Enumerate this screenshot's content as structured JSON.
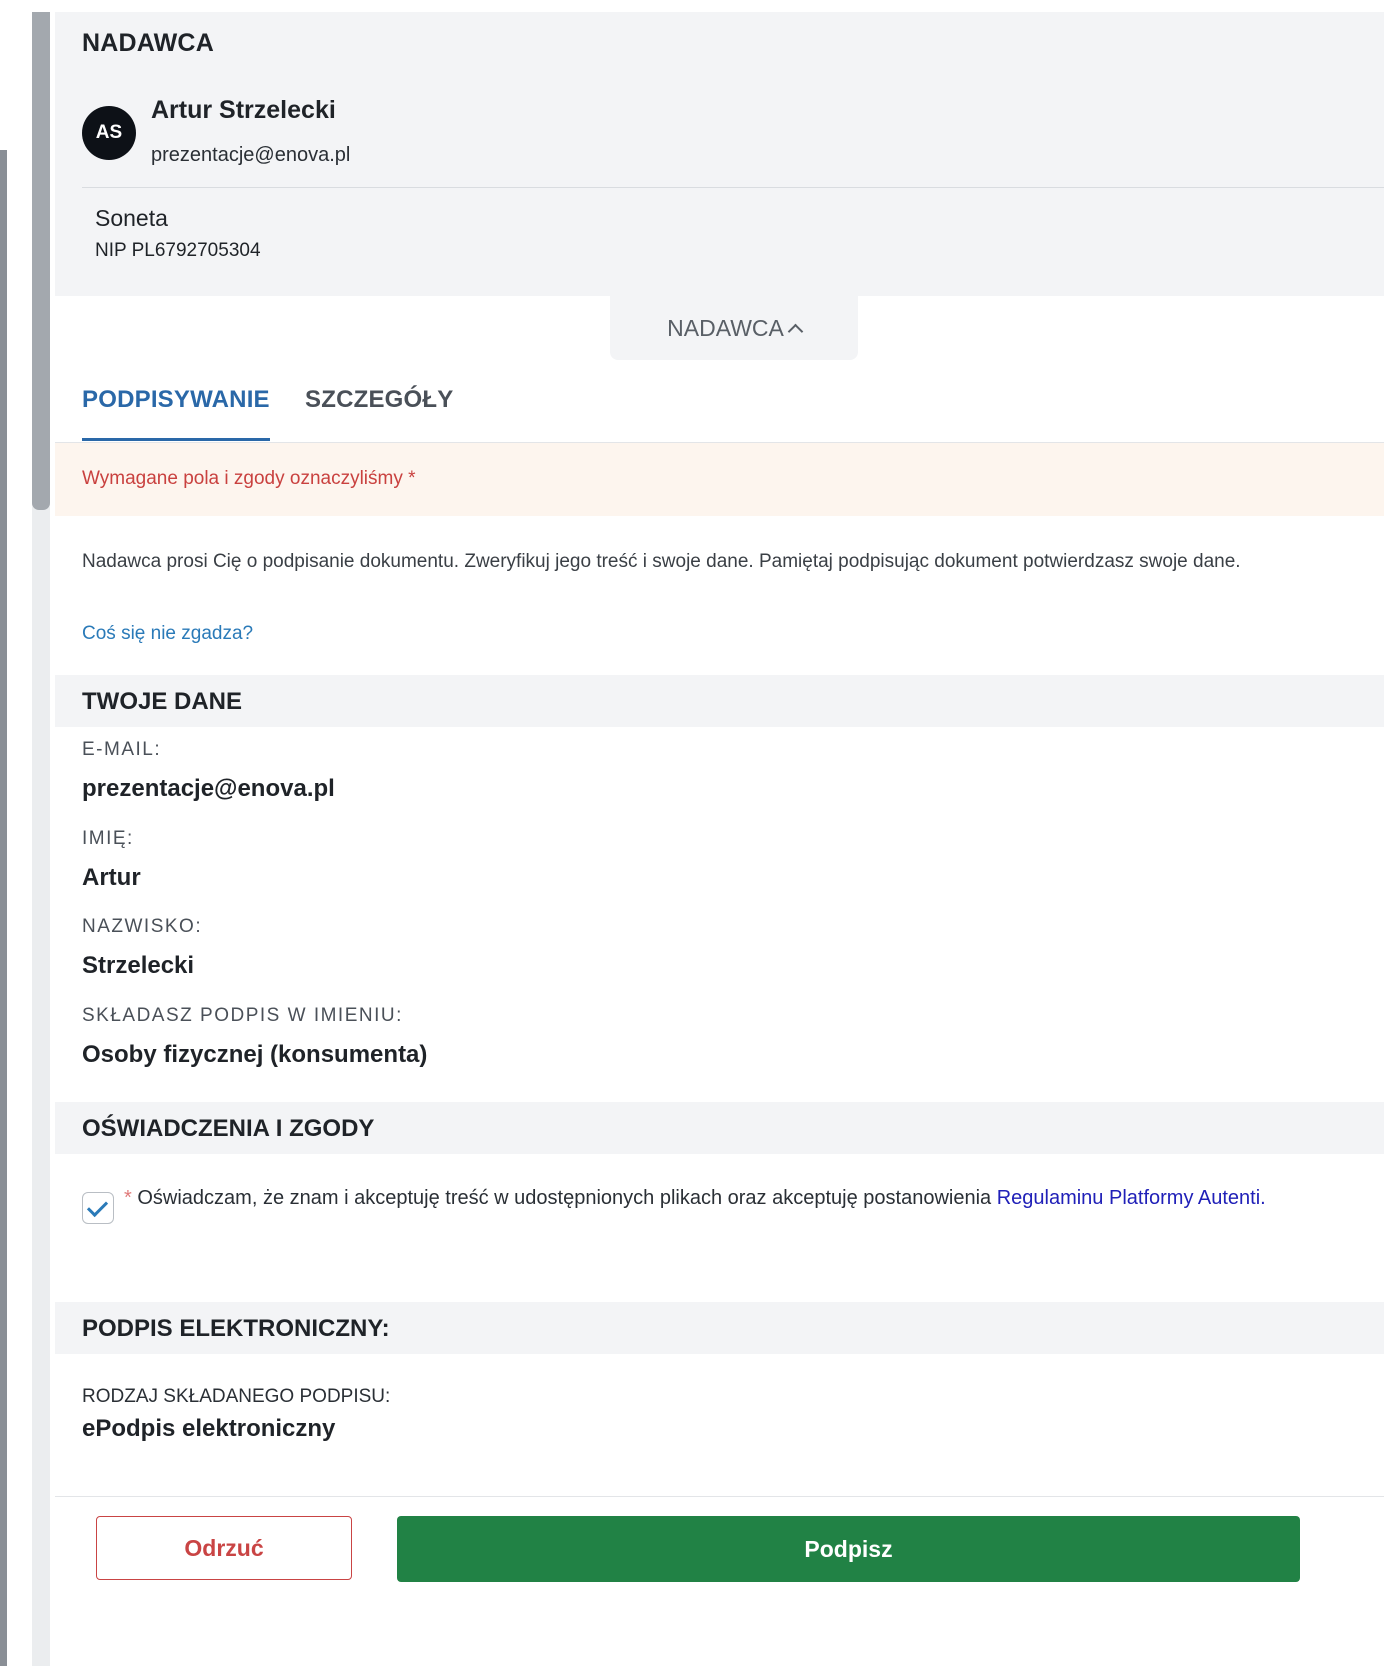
{
  "sender": {
    "heading": "NADAWCA",
    "avatar_initials": "AS",
    "name": "Artur Strzelecki",
    "email": "prezentacje@enova.pl",
    "org_name": "Soneta",
    "org_nip": "NIP PL6792705304",
    "collapse_label": "NADAWCA"
  },
  "tabs": [
    {
      "label": "PODPISYWANIE",
      "active": true
    },
    {
      "label": "SZCZEGÓŁY",
      "active": false
    }
  ],
  "notice": {
    "required_text": "Wymagane pola i zgody oznaczyliśmy *",
    "intro": "Nadawca prosi Cię o podpisanie dokumentu. Zweryfikuj jego treść i swoje dane. Pamiętaj podpisując dokument potwierdzasz swoje dane.",
    "mismatch_link": "Coś się nie zgadza?"
  },
  "your_data": {
    "title": "TWOJE DANE",
    "fields": [
      {
        "label": "E-MAIL:",
        "value": "prezentacje@enova.pl"
      },
      {
        "label": "IMIĘ:",
        "value": "Artur"
      },
      {
        "label": "NAZWISKO:",
        "value": "Strzelecki"
      },
      {
        "label": "SKŁADASZ PODPIS W IMIENIU:",
        "value": "Osoby fizycznej (konsumenta)"
      }
    ]
  },
  "consents": {
    "title": "OŚWIADCZENIA I ZGODY",
    "checked": true,
    "required_mark": "*",
    "text": "Oświadczam, że znam i akceptuję treść w udostępnionych plikach oraz akceptuję postanowienia",
    "link_text": "Regulaminu Platformy Autenti",
    "trailing": "."
  },
  "esign": {
    "title": "PODPIS ELEKTRONICZNY:",
    "type_label": "RODZAJ SKŁADANEGO PODPISU:",
    "type_value": "ePodpis elektroniczny"
  },
  "actions": {
    "reject_label": "Odrzuć",
    "sign_label": "Podpisz"
  },
  "colors": {
    "accent_blue": "#2a68a8",
    "sign_green": "#218245",
    "reject_red": "#c94444"
  }
}
